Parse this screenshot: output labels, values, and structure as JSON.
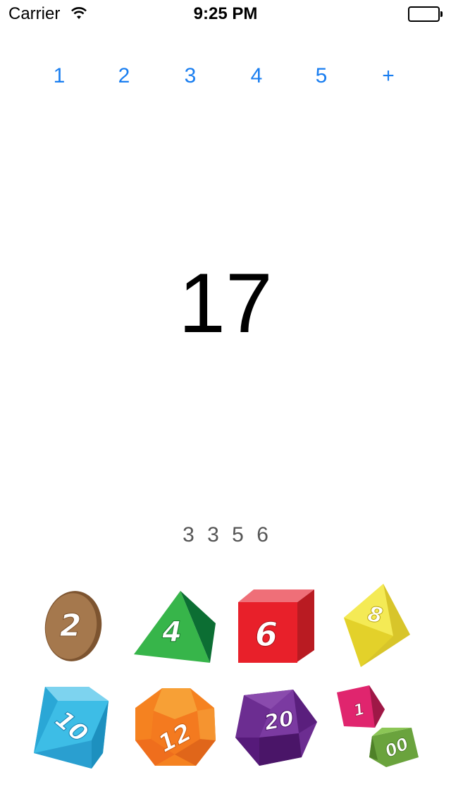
{
  "status_bar": {
    "carrier": "Carrier",
    "time": "9:25 PM",
    "wifi_icon": "wifi-icon",
    "battery_icon": "battery-icon"
  },
  "dice_count_tabs": [
    "1",
    "2",
    "3",
    "4",
    "5",
    "+"
  ],
  "total": "17",
  "rolls": [
    "3",
    "3",
    "5",
    "6"
  ],
  "dice": [
    {
      "name": "d2",
      "label": "2",
      "color": "#a5784d"
    },
    {
      "name": "d4",
      "label": "4",
      "color": "#37b54a"
    },
    {
      "name": "d6",
      "label": "6",
      "color": "#e8202a"
    },
    {
      "name": "d8",
      "label": "8",
      "color": "#eee22f"
    },
    {
      "name": "d10",
      "label": "10",
      "color": "#3dbde6"
    },
    {
      "name": "d12",
      "label": "12",
      "color": "#f58220"
    },
    {
      "name": "d20",
      "label": "20",
      "color": "#6c2d91"
    },
    {
      "name": "d100",
      "label_tens": "1",
      "label_units": "00",
      "colors": [
        "#e0256e",
        "#6aa33d"
      ]
    }
  ],
  "accent_color": "#1a7ef0"
}
